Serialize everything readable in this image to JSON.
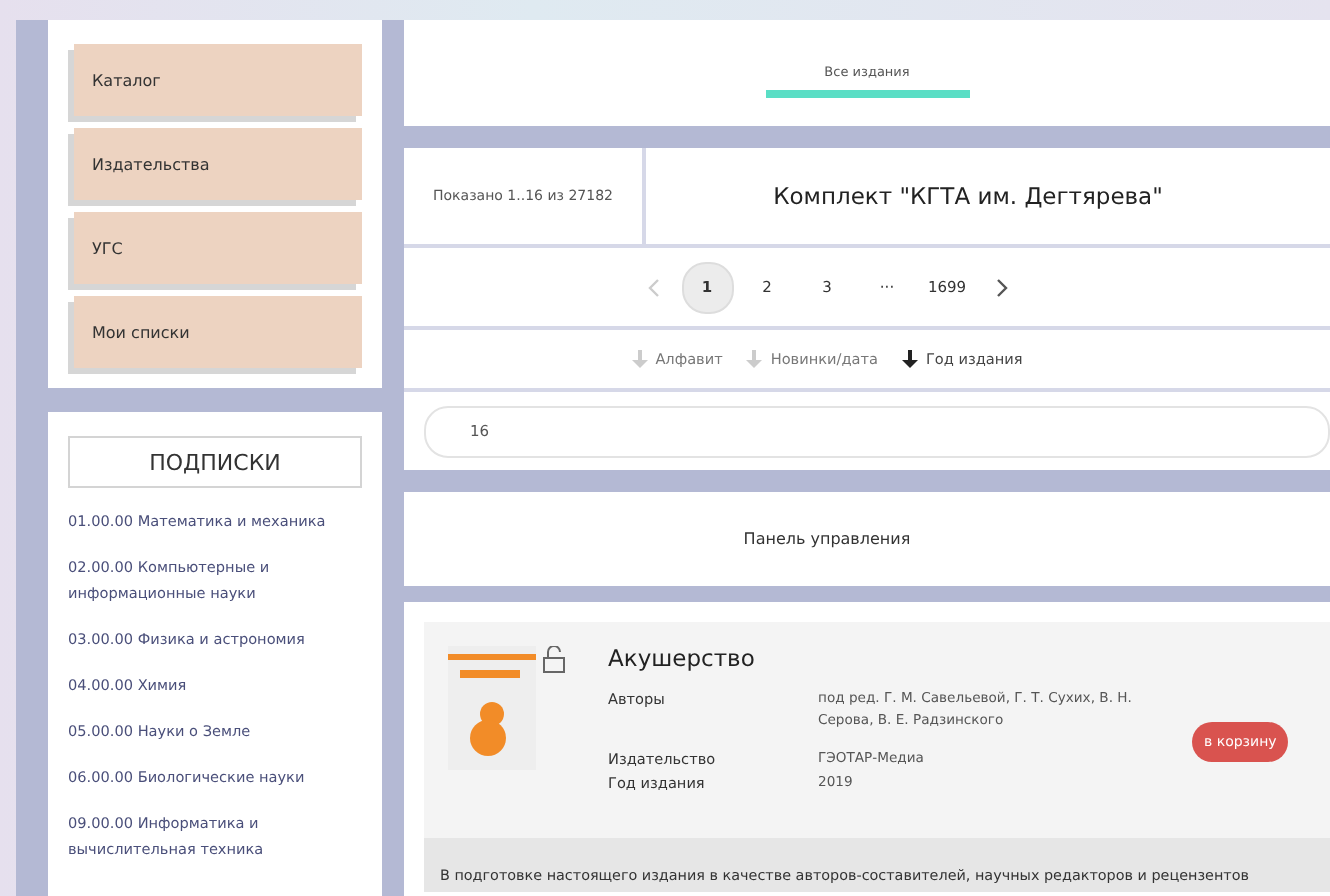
{
  "menu": [
    {
      "label": "Каталог"
    },
    {
      "label": "Издательства"
    },
    {
      "label": "УГС"
    },
    {
      "label": "Мои списки"
    }
  ],
  "subscriptions": {
    "title": "ПОДПИСКИ",
    "items": [
      "01.00.00 Математика и механика",
      "02.00.00 Компьютерные и информационные науки",
      "03.00.00 Физика и астрономия",
      "04.00.00 Химия",
      "05.00.00 Науки о Земле",
      "06.00.00 Биологические науки",
      "09.00.00 Информатика и вычислительная техника"
    ]
  },
  "tabs": [
    {
      "label": "Все издания",
      "selected": true
    }
  ],
  "shown": "Показано 1..16 из 27182",
  "collection_title": "Комплект \"КГТА им. Дегтярева\"",
  "pagination": [
    {
      "label": "1",
      "selected": true
    },
    {
      "label": "2",
      "selected": false
    },
    {
      "label": "3",
      "selected": false
    },
    {
      "label": "···",
      "selected": false
    },
    {
      "label": "1699",
      "selected": false
    }
  ],
  "sort": [
    {
      "label": "Алфавит",
      "selected": false
    },
    {
      "label": "Новинки/дата",
      "selected": false
    },
    {
      "label": "Год издания",
      "selected": true
    }
  ],
  "per_page": "16",
  "control_panel": "Панель управления",
  "book": {
    "title": "Акушерство",
    "fields": [
      {
        "label": "Авторы",
        "value": "под ред. Г. М. Савельевой, Г. Т. Сухих, В. Н. Серова, В. Е. Радзинского"
      },
      {
        "label": "Издательство",
        "value": "ГЭОТАР-Медиа"
      },
      {
        "label": "Год издания",
        "value": "2019"
      }
    ],
    "cart": "в корзину",
    "description": "В подготовке настоящего издания в качестве авторов-составителей, научных редакторов и рецензентов"
  }
}
